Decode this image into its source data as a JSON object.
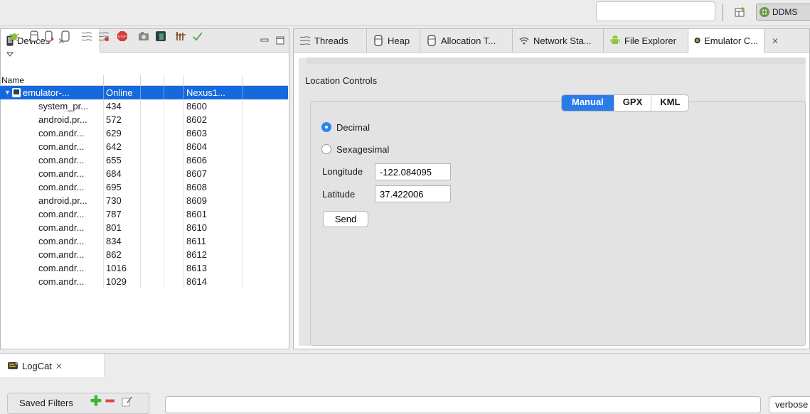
{
  "toolbar": {
    "quick_access_placeholder": "",
    "ddms_label": "DDMS"
  },
  "devices": {
    "tab_label": "Devices",
    "column_header": "Name",
    "device": {
      "name": "emulator-...",
      "state": "Online",
      "avd": "Nexus1..."
    },
    "processes": [
      {
        "name": "system_pr...",
        "pid": "434",
        "port": "8600"
      },
      {
        "name": "android.pr...",
        "pid": "572",
        "port": "8602"
      },
      {
        "name": "com.andr...",
        "pid": "629",
        "port": "8603"
      },
      {
        "name": "com.andr...",
        "pid": "642",
        "port": "8604"
      },
      {
        "name": "com.andr...",
        "pid": "655",
        "port": "8606"
      },
      {
        "name": "com.andr...",
        "pid": "684",
        "port": "8607"
      },
      {
        "name": "com.andr...",
        "pid": "695",
        "port": "8608"
      },
      {
        "name": "android.pr...",
        "pid": "730",
        "port": "8609"
      },
      {
        "name": "com.andr...",
        "pid": "787",
        "port": "8601"
      },
      {
        "name": "com.andr...",
        "pid": "801",
        "port": "8610"
      },
      {
        "name": "com.andr...",
        "pid": "834",
        "port": "8611"
      },
      {
        "name": "com.andr...",
        "pid": "862",
        "port": "8612"
      },
      {
        "name": "com.andr...",
        "pid": "1016",
        "port": "8613"
      },
      {
        "name": "com.andr...",
        "pid": "1029",
        "port": "8614"
      }
    ]
  },
  "right_tabs": [
    {
      "label": "Threads",
      "icon": "threads-icon"
    },
    {
      "label": "Heap",
      "icon": "heap-icon"
    },
    {
      "label": "Allocation T...",
      "icon": "allocation-icon"
    },
    {
      "label": "Network Sta...",
      "icon": "network-icon"
    },
    {
      "label": "File Explorer",
      "icon": "android-icon"
    },
    {
      "label": "Emulator C...",
      "icon": "emulator-icon"
    }
  ],
  "location": {
    "title": "Location Controls",
    "segments": [
      "Manual",
      "GPX",
      "KML"
    ],
    "selected_segment": "Manual",
    "format_decimal": "Decimal",
    "format_sexagesimal": "Sexagesimal",
    "selected_format": "Decimal",
    "longitude_label": "Longitude",
    "longitude_value": "-122.084095",
    "latitude_label": "Latitude",
    "latitude_value": "37.422006",
    "send_label": "Send"
  },
  "logcat": {
    "tab_label": "LogCat",
    "saved_filters_label": "Saved Filters",
    "filter_placeholder": "",
    "level_value": "verbose"
  },
  "colors": {
    "selection": "#1569dd",
    "accent": "#2b7ce9"
  }
}
